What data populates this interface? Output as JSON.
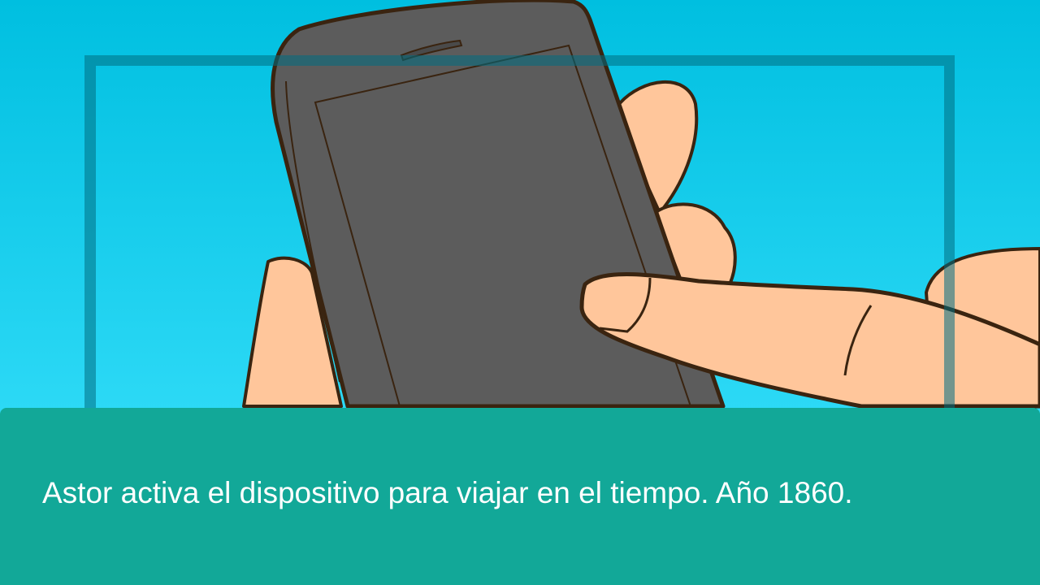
{
  "scene": {
    "caption": "Astor activa el dispositivo para viajar en el tiempo. Año 1860."
  },
  "colors": {
    "sky_top": "#00bfe0",
    "sky_bottom": "#3fe4ff",
    "frame_overlay": "#006e82",
    "phone_body": "#5c5c5c",
    "outline": "#3a2410",
    "skin": "#ffc69b",
    "caption_panel": "#12a898",
    "caption_text": "#ffffff"
  },
  "icons": [
    "phone-icon",
    "hand-icon"
  ]
}
